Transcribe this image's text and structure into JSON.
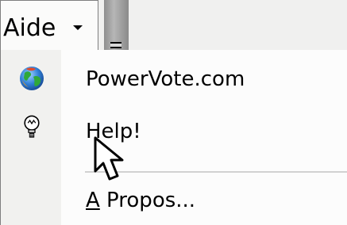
{
  "menubar": {
    "menu_title": "Aide"
  },
  "menu": {
    "items": [
      {
        "label": "PowerVote.com",
        "icon": "globe-icon"
      },
      {
        "label": "Help!",
        "icon": "lightbulb-icon"
      },
      {
        "label_mnemonic": "A",
        "label_rest": " Propos..."
      }
    ]
  },
  "colors": {
    "menu_border": "#7f7f7f",
    "icon_column": "#f1f1ef",
    "menubar_background": "#f0f0ef",
    "separator": "#d1d1d1"
  }
}
